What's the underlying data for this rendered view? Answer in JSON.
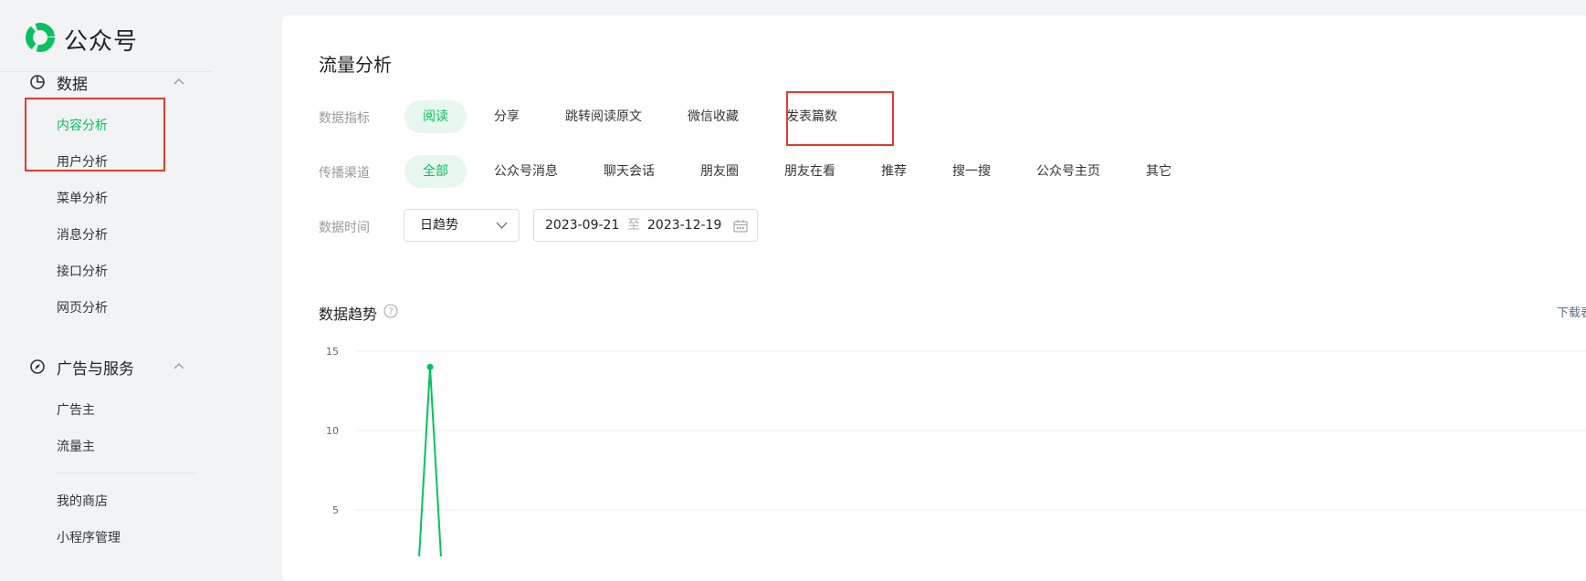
{
  "app": {
    "name": "公众号",
    "brand_color": "#07c160"
  },
  "sidebar": {
    "sections": [
      {
        "label": "数据",
        "icon": "pie-chart-icon",
        "items": [
          "内容分析",
          "用户分析",
          "菜单分析",
          "消息分析",
          "接口分析",
          "网页分析"
        ]
      },
      {
        "label": "广告与服务",
        "icon": "compass-icon",
        "items": [
          "广告主",
          "流量主"
        ]
      }
    ],
    "extra_items": [
      "我的商店",
      "小程序管理"
    ],
    "active_item": "内容分析"
  },
  "page": {
    "title": "流量分析",
    "metric_row": {
      "label": "数据指标",
      "options": [
        "阅读",
        "分享",
        "跳转阅读原文",
        "微信收藏",
        "发表篇数"
      ],
      "selected": "阅读"
    },
    "channel_row": {
      "label": "传播渠道",
      "options": [
        "全部",
        "公众号消息",
        "聊天会话",
        "朋友圈",
        "朋友在看",
        "推荐",
        "搜一搜",
        "公众号主页",
        "其它"
      ],
      "selected": "全部"
    },
    "time_row": {
      "label": "数据时间",
      "granularity": "日趋势",
      "start_date": "2023-09-21",
      "range_sep": "至",
      "end_date": "2023-12-19",
      "icons": [
        "chevron-down-icon",
        "calendar-icon"
      ]
    },
    "trend": {
      "title": "数据趋势",
      "help_icon": "help-icon",
      "download_label": "下载表"
    }
  },
  "chart_data": {
    "type": "line",
    "y_ticks": [
      "15",
      "10",
      "5"
    ],
    "ylim": [
      0,
      15
    ],
    "grid": true,
    "series": [
      {
        "values": [
          0,
          14,
          0
        ],
        "color": "#07c160"
      }
    ]
  },
  "annotation_color": "#e23a2d"
}
